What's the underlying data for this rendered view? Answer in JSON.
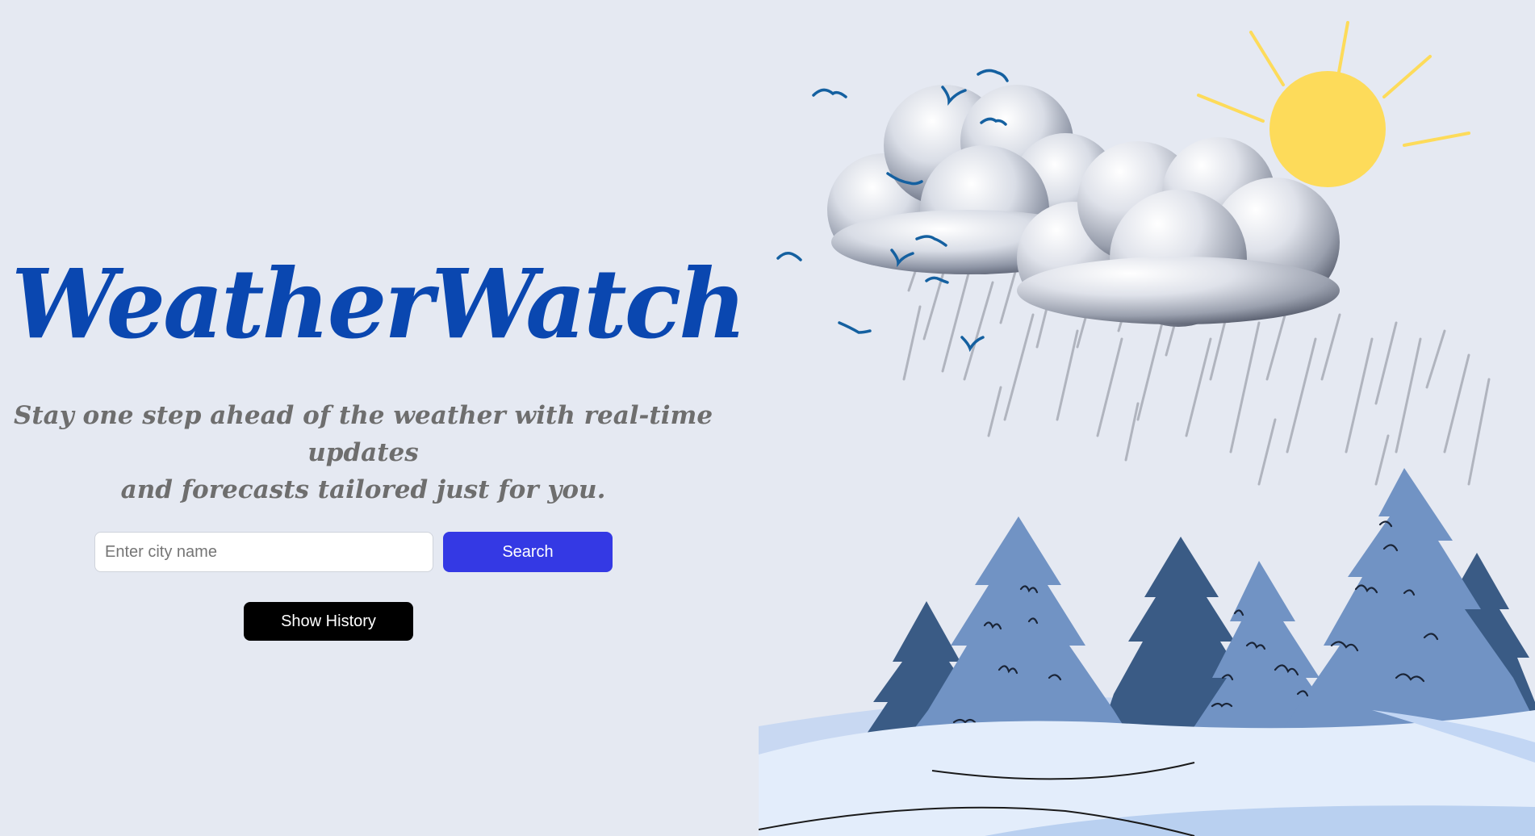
{
  "hero": {
    "title": "WeatherWatch",
    "tagline_line1": "Stay one step ahead of the weather with real-time updates",
    "tagline_line2": "and forecasts tailored just for you."
  },
  "search": {
    "placeholder": "Enter city name",
    "value": "",
    "button_label": "Search"
  },
  "history": {
    "button_label": "Show History"
  },
  "illustration": {
    "icons": [
      "sun-icon",
      "cloud-icon",
      "rain-icon",
      "bird-icon",
      "pine-tree-icon",
      "snow-ground"
    ]
  },
  "colors": {
    "background": "#e5e9f2",
    "title": "#0a47b0",
    "tagline": "#6e6e6e",
    "search_button": "#3439e4",
    "history_button": "#000000",
    "sun": "#fddb5a",
    "tree_light": "#7193c4",
    "tree_dark": "#3a5b85",
    "bird": "#1460a0",
    "snow": "#e3edfb"
  }
}
